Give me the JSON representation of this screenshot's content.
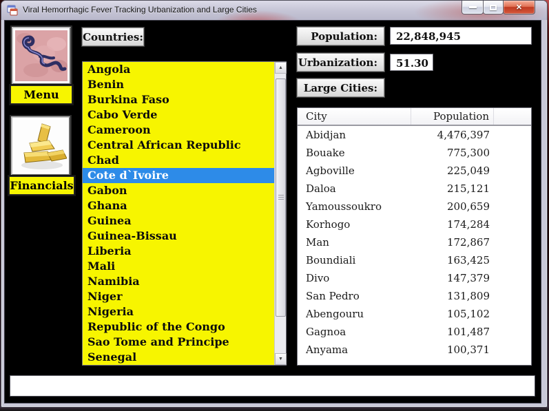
{
  "window": {
    "title": "Viral Hemorrhagic Fever Tracking Urbanization and Large Cities"
  },
  "icons": {
    "minimize": "minimize-bar",
    "maximize": "restore-box",
    "close_glyph": "✕",
    "scroll_up_glyph": "▲",
    "scroll_down_glyph": "▼"
  },
  "sidebar": {
    "menu_label": "Menu",
    "financials_label": "Financials",
    "ebola_image": "ebola-virus-micrograph",
    "gold_image": "gold-bars-stack"
  },
  "countries_panel": {
    "label": "Countries:",
    "selected_item": "Cote d`Ivoire",
    "items": [
      "Angola",
      "Benin",
      "Burkina Faso",
      "Cabo Verde",
      "Cameroon",
      "Central African Republic",
      "Chad",
      "Cote d`Ivoire",
      "Gabon",
      "Ghana",
      "Guinea",
      "Guinea-Bissau",
      "Liberia",
      "Mali",
      "Namibia",
      "Niger",
      "Nigeria",
      "Republic of the Congo",
      "Sao Tome and Principe",
      "Senegal"
    ]
  },
  "details_panel": {
    "population_label": "Population:",
    "population_value": "22,848,945",
    "urbanization_label": "Urbanization:",
    "urbanization_value": "51.30",
    "large_cities_label": "Large Cities:"
  },
  "cities_table": {
    "columns": [
      "City",
      "Population"
    ],
    "rows": [
      [
        "Abidjan",
        "4,476,397"
      ],
      [
        "Bouake",
        "775,300"
      ],
      [
        "Agboville",
        "225,049"
      ],
      [
        "Daloa",
        "215,121"
      ],
      [
        "Yamoussoukro",
        "200,659"
      ],
      [
        "Korhogo",
        "174,284"
      ],
      [
        "Man",
        "172,867"
      ],
      [
        "Boundiali",
        "163,425"
      ],
      [
        "Divo",
        "147,379"
      ],
      [
        "San Pedro",
        "131,809"
      ],
      [
        "Abengouru",
        "105,102"
      ],
      [
        "Gagnoa",
        "101,487"
      ],
      [
        "Anyama",
        "100,371"
      ]
    ]
  },
  "status_box": {
    "value": ""
  },
  "colors": {
    "list_yellow": "#f7f500",
    "selection_blue": "#2d8be8",
    "close_button_red": "#bf3b22",
    "client_black": "#000000",
    "titlebar_lavender": "#c6c5d6"
  }
}
